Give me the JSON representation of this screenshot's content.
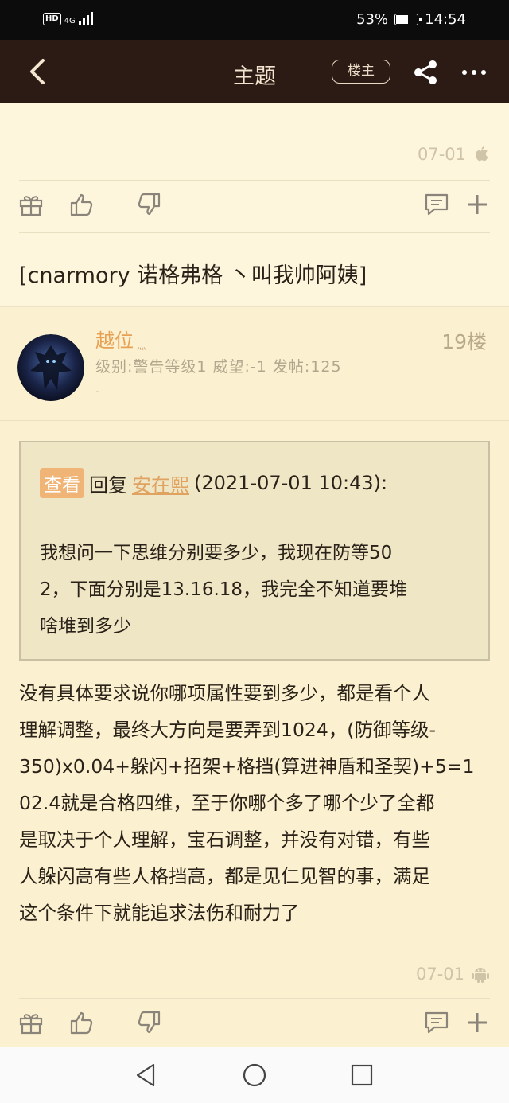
{
  "status": {
    "network": "4G",
    "hd": "HD",
    "battery": "53%",
    "time": "14:54"
  },
  "header": {
    "title": "主题",
    "louzhu_label": "楼主"
  },
  "prev_post": {
    "date": "07-01",
    "device_icon": "apple-icon",
    "quote": "[cnarmory 诺格弗格 丶叫我帅阿姨]"
  },
  "post": {
    "username": "越位",
    "username_deco": "灬",
    "floor": "19楼",
    "user_info": "级别:警告等级1 威望:-1 发帖:125",
    "user_info_extra": "-",
    "quote": {
      "view_label": "查看",
      "reply_label": "回复",
      "reply_to": "安在熙",
      "reply_time": "(2021-07-01 10:43):",
      "lines": [
        "我想问一下思维分别要多少，我现在防等50",
        "2，下面分别是13.16.18，我完全不知道要堆",
        "啥堆到多少"
      ]
    },
    "body_lines": [
      "没有具体要求说你哪项属性要到多少，都是看个人",
      "理解调整，最终大方向是要弄到1024，(防御等级-",
      "350)x0.04+躲闪+招架+格挡(算进神盾和圣契)+5=1",
      "02.4就是合格四维，至于你哪个多了哪个少了全都",
      "是取决于个人理解，宝石调整，并没有对错，有些",
      "人躲闪高有些人格挡高，都是见仁见智的事，满足",
      "这个条件下就能追求法伤和耐力了"
    ],
    "date": "07-01",
    "device_icon": "android-icon"
  },
  "colors": {
    "header_bg": "#2b1b14",
    "page_bg": "#fdf5dc",
    "accent": "#e7a155"
  }
}
